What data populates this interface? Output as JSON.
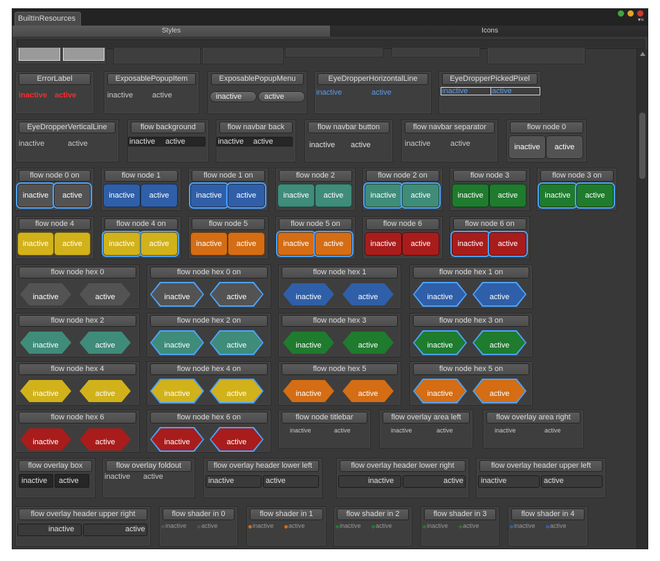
{
  "window": {
    "tab_title": "BuiltInResources"
  },
  "toolbar": {
    "styles_label": "Styles",
    "icons_label": "Icons"
  },
  "colors": {
    "gray": "#535353",
    "blue": "#2f5fa8",
    "teal": "#3f8c7a",
    "green": "#1f7b2e",
    "yellow": "#d2b21a",
    "orange": "#d46d14",
    "red": "#a91c1c",
    "highlight": "#4ba3ff"
  },
  "states": {
    "inactive": "inactive",
    "active": "active"
  },
  "styles": [
    {
      "name": "ErrorLabel",
      "kind": "error"
    },
    {
      "name": "ExposablePopupItem",
      "kind": "text"
    },
    {
      "name": "ExposablePopupMenu",
      "kind": "popup"
    },
    {
      "name": "EyeDropperHorizontalLine",
      "kind": "bluetext"
    },
    {
      "name": "EyeDropperPickedPixel",
      "kind": "bluebox"
    },
    {
      "name": "EyeDropperVerticalLine",
      "kind": "text"
    },
    {
      "name": "flow background",
      "kind": "darkbar"
    },
    {
      "name": "flow navbar back",
      "kind": "darkbar"
    },
    {
      "name": "flow navbar button",
      "kind": "plain"
    },
    {
      "name": "flow navbar separator",
      "kind": "text"
    },
    {
      "name": "flow node 0",
      "kind": "node",
      "color": "gray"
    },
    {
      "name": "flow node 0 on",
      "kind": "node",
      "color": "gray",
      "on": true
    },
    {
      "name": "flow node 1",
      "kind": "node",
      "color": "blue"
    },
    {
      "name": "flow node 1 on",
      "kind": "node",
      "color": "blue",
      "on": true
    },
    {
      "name": "flow node 2",
      "kind": "node",
      "color": "teal"
    },
    {
      "name": "flow node 2 on",
      "kind": "node",
      "color": "teal",
      "on": true
    },
    {
      "name": "flow node 3",
      "kind": "node",
      "color": "green"
    },
    {
      "name": "flow node 3 on",
      "kind": "node",
      "color": "green",
      "on": true
    },
    {
      "name": "flow node 4",
      "kind": "node",
      "color": "yellow"
    },
    {
      "name": "flow node 4 on",
      "kind": "node",
      "color": "yellow",
      "on": true
    },
    {
      "name": "flow node 5",
      "kind": "node",
      "color": "orange"
    },
    {
      "name": "flow node 5 on",
      "kind": "node",
      "color": "orange",
      "on": true
    },
    {
      "name": "flow node 6",
      "kind": "node",
      "color": "red"
    },
    {
      "name": "flow node 6 on",
      "kind": "node",
      "color": "red",
      "on": true
    },
    {
      "name": "flow node hex 0",
      "kind": "hex",
      "color": "gray"
    },
    {
      "name": "flow node hex 0 on",
      "kind": "hex",
      "color": "gray",
      "on": true
    },
    {
      "name": "flow node hex 1",
      "kind": "hex",
      "color": "blue"
    },
    {
      "name": "flow node hex 1 on",
      "kind": "hex",
      "color": "blue",
      "on": true
    },
    {
      "name": "flow node hex 2",
      "kind": "hex",
      "color": "teal"
    },
    {
      "name": "flow node hex 2 on",
      "kind": "hex",
      "color": "teal",
      "on": true
    },
    {
      "name": "flow node hex 3",
      "kind": "hex",
      "color": "green"
    },
    {
      "name": "flow node hex 3 on",
      "kind": "hex",
      "color": "green",
      "on": true
    },
    {
      "name": "flow node hex 4",
      "kind": "hex",
      "color": "yellow"
    },
    {
      "name": "flow node hex 4 on",
      "kind": "hex",
      "color": "yellow",
      "on": true
    },
    {
      "name": "flow node hex 5",
      "kind": "hex",
      "color": "orange"
    },
    {
      "name": "flow node hex 5 on",
      "kind": "hex",
      "color": "orange",
      "on": true
    },
    {
      "name": "flow node hex 6",
      "kind": "hex",
      "color": "red"
    },
    {
      "name": "flow node hex 6 on",
      "kind": "hex",
      "color": "red",
      "on": true
    },
    {
      "name": "flow node titlebar",
      "kind": "small"
    },
    {
      "name": "flow overlay area left",
      "kind": "small"
    },
    {
      "name": "flow overlay area right",
      "kind": "small"
    },
    {
      "name": "flow overlay box",
      "kind": "overlaybox"
    },
    {
      "name": "flow overlay foldout",
      "kind": "foldout"
    },
    {
      "name": "flow overlay header lower left",
      "kind": "header-left"
    },
    {
      "name": "flow overlay header lower right",
      "kind": "header-right"
    },
    {
      "name": "flow overlay header upper left",
      "kind": "header-left"
    },
    {
      "name": "flow overlay header upper right",
      "kind": "header-right"
    },
    {
      "name": "flow shader in 0",
      "kind": "shader",
      "color": "gray"
    },
    {
      "name": "flow shader in 1",
      "kind": "shader",
      "color": "orange"
    },
    {
      "name": "flow shader in 2",
      "kind": "shader",
      "color": "green"
    },
    {
      "name": "flow shader in 3",
      "kind": "shader",
      "color": "green"
    },
    {
      "name": "flow shader in 4",
      "kind": "shader",
      "color": "blue"
    }
  ]
}
